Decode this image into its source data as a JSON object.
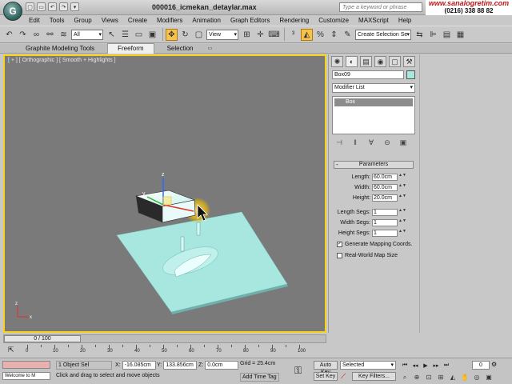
{
  "app": {
    "logo_glyph": "G",
    "title": "000016_icmekan_detaylar.max",
    "search_placeholder": "Type a keyword or phrase",
    "brand_name": "www.sanalogretim.com",
    "brand_phone": "(0216) 338 88 82"
  },
  "quick_access": [
    "▢",
    "▭",
    "↶",
    "↷",
    "▾"
  ],
  "menu": [
    "Edit",
    "Tools",
    "Group",
    "Views",
    "Create",
    "Modifiers",
    "Animation",
    "Graph Editors",
    "Rendering",
    "Customize",
    "MAXScript",
    "Help"
  ],
  "toolbar": {
    "filter_value": "All",
    "refcoord_value": "View",
    "selection_set_placeholder": "Create Selection Se"
  },
  "ribbon": {
    "tabs": [
      "Graphite Modeling Tools",
      "Freeform",
      "Selection"
    ],
    "selected": 1
  },
  "viewport": {
    "label": "[ + ] [ Orthographic ] [ Smooth + Highlights ]",
    "gizmo_z": "z",
    "gizmo_x": "x",
    "gizmo_y": "y"
  },
  "command_panel": {
    "object_name": "Box09",
    "object_color": "#a8e6e0",
    "modifier_list": "Modifier List",
    "stack_item": "Box",
    "rollout_title": "Parameters",
    "params": [
      {
        "label": "Length:",
        "value": "60.0cm"
      },
      {
        "label": "Width:",
        "value": "60.0cm"
      },
      {
        "label": "Height:",
        "value": "20.0cm"
      }
    ],
    "segs": [
      {
        "label": "Length Segs:",
        "value": "1"
      },
      {
        "label": "Width Segs:",
        "value": "1"
      },
      {
        "label": "Height Segs:",
        "value": "1"
      }
    ],
    "gen_mapping": "Generate Mapping Coords.",
    "real_world": "Real-World Map Size"
  },
  "timeline": {
    "slider_label": "0 / 100",
    "ticks": [
      "0",
      "10",
      "20",
      "30",
      "40",
      "50",
      "60",
      "70",
      "80",
      "90",
      "100"
    ]
  },
  "status": {
    "listener_text": "Welcome to M",
    "selection_count": "1 Object Sel",
    "prompt": "Click and drag to select and move objects",
    "x_label": "X:",
    "x_value": "-16.085cm",
    "y_label": "Y:",
    "y_value": "133.856cm",
    "z_label": "Z:",
    "z_value": "0.0cm",
    "grid": "Grid = 25.4cm",
    "add_time_tag": "Add Time Tag",
    "auto_key": "Auto Key",
    "set_key": "Set Key",
    "selected": "Selected",
    "key_filters": "Key Filters...",
    "frame": "0"
  }
}
